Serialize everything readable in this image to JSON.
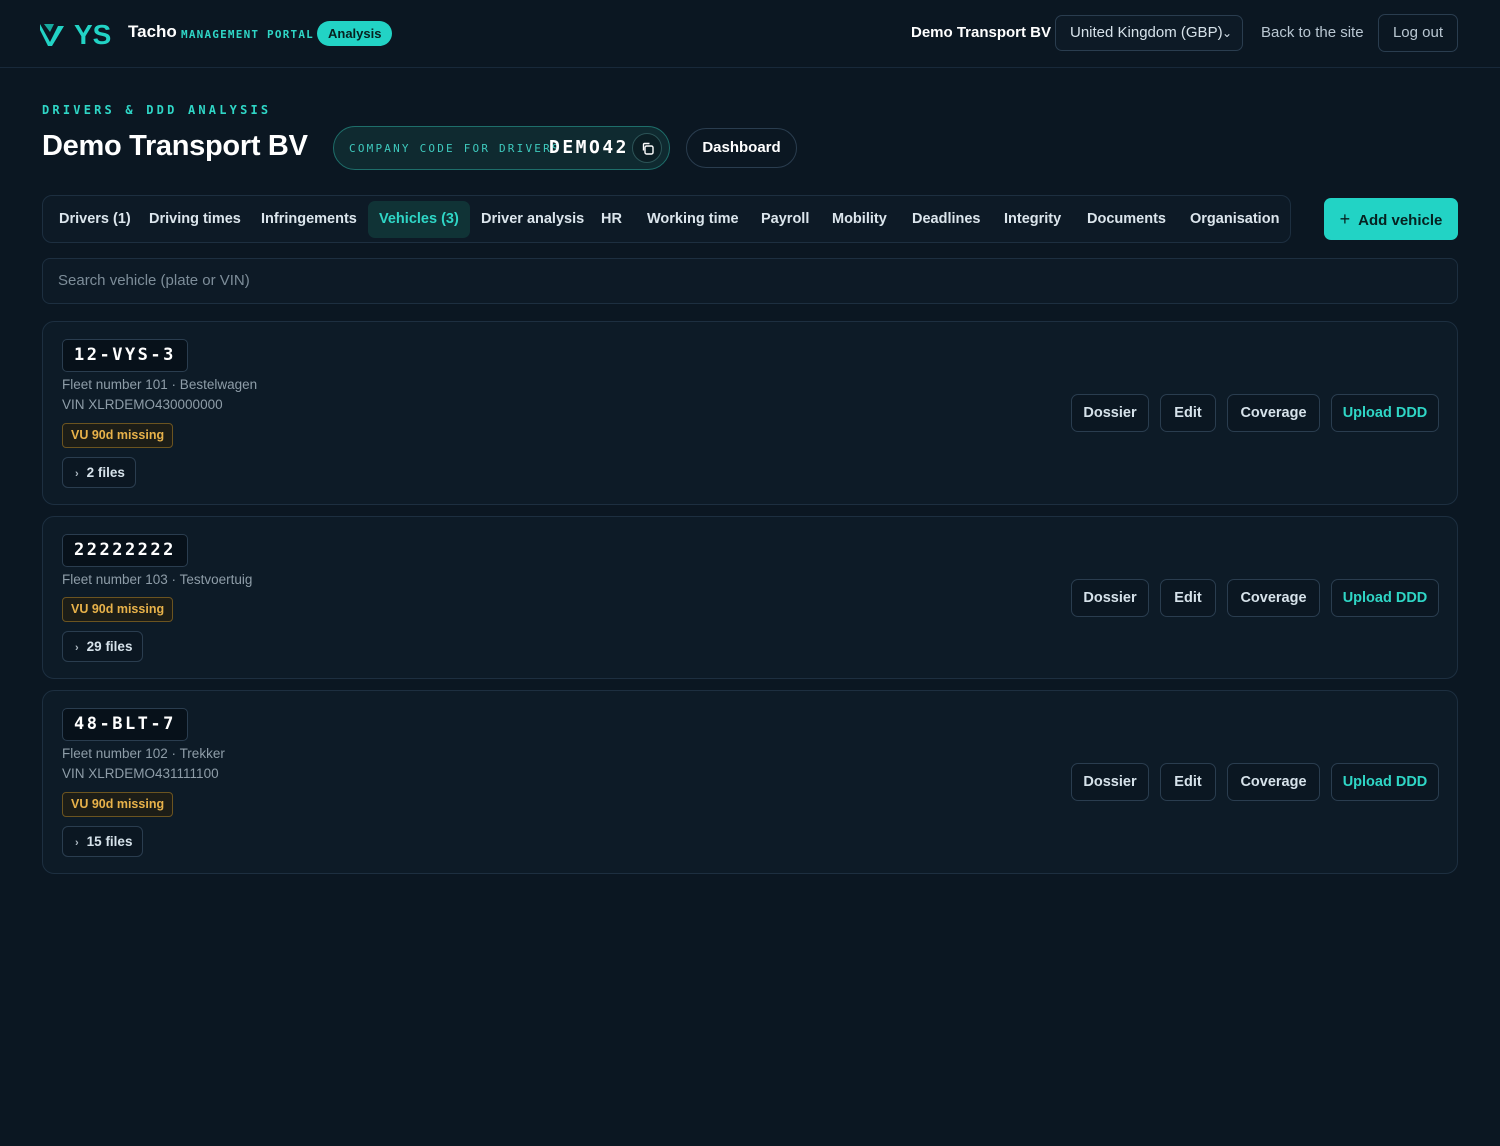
{
  "topbar": {
    "brand_mark": "VYS",
    "brand_name": "Tacho",
    "brand_sub": "MANAGEMENT PORTAL",
    "mode_pill": "Analysis",
    "company": "Demo Transport BV",
    "country_select": "United Kingdom (GBP)",
    "back_link": "Back to the site",
    "logout": "Log out"
  },
  "header": {
    "eyebrow": "DRIVERS & DDD ANALYSIS",
    "title": "Demo Transport BV",
    "code_label": "COMPANY CODE FOR DRIVERS",
    "code_value": "DEMO42",
    "dashboard": "Dashboard"
  },
  "tabs": [
    {
      "label": "Drivers (1)",
      "active": false
    },
    {
      "label": "Driving times",
      "active": false
    },
    {
      "label": "Infringements",
      "active": false
    },
    {
      "label": "Vehicles (3)",
      "active": true
    },
    {
      "label": "Driver analysis",
      "active": false
    },
    {
      "label": "HR",
      "active": false
    },
    {
      "label": "Working time",
      "active": false
    },
    {
      "label": "Payroll",
      "active": false
    },
    {
      "label": "Mobility",
      "active": false
    },
    {
      "label": "Deadlines",
      "active": false
    },
    {
      "label": "Integrity",
      "active": false
    },
    {
      "label": "Documents",
      "active": false
    },
    {
      "label": "Organisation",
      "active": false
    }
  ],
  "add_vehicle": "Add vehicle",
  "search": {
    "placeholder": "Search vehicle (plate or VIN)"
  },
  "vehicles": [
    {
      "plate": "12-VYS-3",
      "fleet": "Fleet number 101 · Bestelwagen",
      "vin": "VIN XLRDEMO430000000",
      "badge": "VU 90d missing",
      "files": "2 files"
    },
    {
      "plate": "22222222",
      "fleet": "Fleet number 103 · Testvoertuig",
      "vin": "",
      "badge": "VU 90d missing",
      "files": "29 files"
    },
    {
      "plate": "48-BLT-7",
      "fleet": "Fleet number 102 · Trekker",
      "vin": "VIN XLRDEMO431111100",
      "badge": "VU 90d missing",
      "files": "15 files"
    }
  ],
  "actions": {
    "dossier": "Dossier",
    "edit": "Edit",
    "coverage": "Coverage",
    "upload": "Upload DDD"
  },
  "colors": {
    "background": "#0b1722",
    "accent": "#22d3c5",
    "warning": "#e8b24a"
  },
  "icons": {
    "copy": "copy-icon",
    "chevron": "chevron-right-icon",
    "plus": "plus-icon",
    "select": "chevron-down-icon"
  }
}
